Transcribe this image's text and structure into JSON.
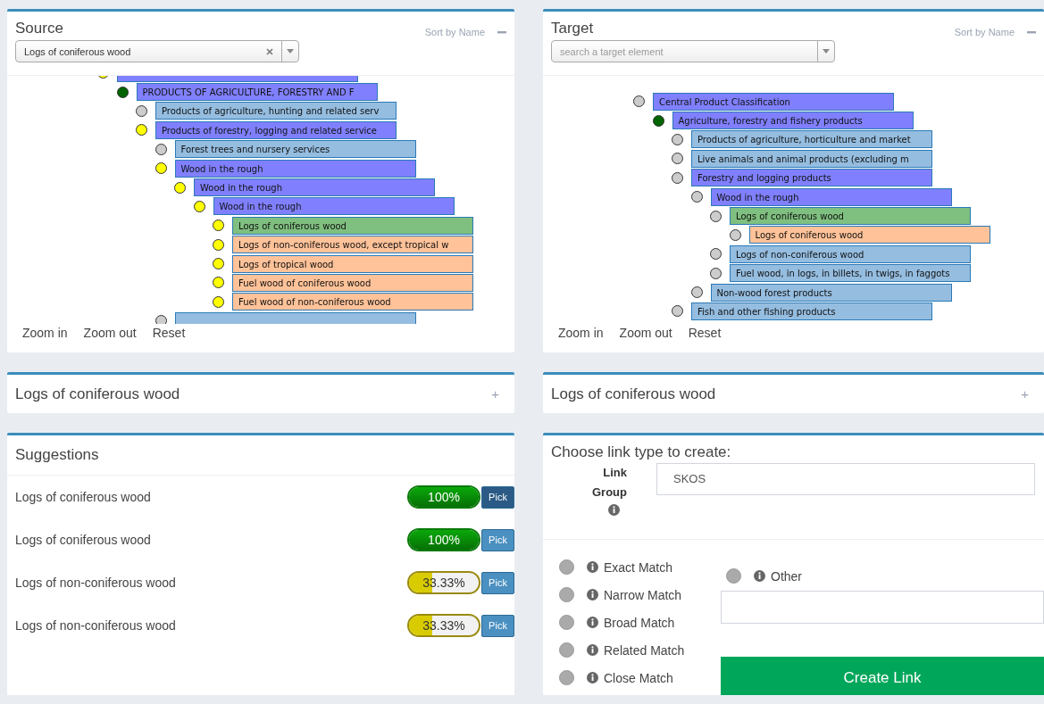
{
  "source": {
    "title": "Source",
    "sort_link": "Sort by Name",
    "search": {
      "value": "Logs of coniferous wood"
    },
    "tree": [
      {
        "kind": "group",
        "color": "#ffff00",
        "children": [
          {
            "label": "PRODUCTS OF AGRICULTURE, FORESTRY AND F",
            "kind": "group",
            "color": "#006400",
            "children": [
              {
                "label": "Products of agriculture, hunting and related serv",
                "kind": "other",
                "color": "#cccccc"
              },
              {
                "label": "Products of forestry, logging and related service",
                "kind": "group",
                "color": "#ffff00",
                "children": [
                  {
                    "label": "Forest trees and nursery services",
                    "kind": "other",
                    "color": "#cccccc"
                  },
                  {
                    "label": "Wood in the rough",
                    "kind": "group",
                    "color": "#ffff00",
                    "children": [
                      {
                        "label": "Wood in the rough",
                        "kind": "group",
                        "color": "#ffff00",
                        "children": [
                          {
                            "label": "Wood in the rough",
                            "kind": "group",
                            "color": "#ffff00",
                            "children": [
                              {
                                "label": "Logs of coniferous wood",
                                "kind": "match",
                                "color": "#ffff00"
                              },
                              {
                                "label": "Logs of non-coniferous wood, except tropical w",
                                "kind": "candidate",
                                "color": "#ffff00"
                              },
                              {
                                "label": "Logs of tropical wood",
                                "kind": "candidate",
                                "color": "#ffff00"
                              },
                              {
                                "label": "Fuel wood of coniferous wood",
                                "kind": "candidate",
                                "color": "#ffff00"
                              },
                              {
                                "label": "Fuel wood of non-coniferous wood",
                                "kind": "candidate",
                                "color": "#ffff00"
                              }
                            ]
                          }
                        ]
                      }
                    ]
                  },
                  {
                    "kind": "other",
                    "color": "#cccccc"
                  }
                ]
              }
            ]
          }
        ]
      }
    ],
    "zoom_links": [
      "Zoom in",
      "Zoom out",
      "Reset"
    ]
  },
  "target": {
    "title": "Target",
    "sort_link": "Sort by Name",
    "search": {
      "placeholder": "search a target element"
    },
    "tree": [
      {
        "label": "Central Product Classification",
        "kind": "group",
        "color": "#cccccc",
        "children": [
          {
            "label": "Agriculture, forestry and fishery products",
            "kind": "group",
            "color": "#006400",
            "children": [
              {
                "label": "Products of agriculture, horticulture and market",
                "kind": "other",
                "color": "#cccccc"
              },
              {
                "label": "Live animals and animal products (excluding m",
                "kind": "other",
                "color": "#cccccc"
              },
              {
                "label": "Forestry and logging products",
                "kind": "group",
                "color": "#cccccc",
                "children": [
                  {
                    "label": "Wood in the rough",
                    "kind": "group",
                    "color": "#cccccc",
                    "children": [
                      {
                        "label": "Logs of coniferous wood",
                        "kind": "match",
                        "color": "#cccccc",
                        "children": [
                          {
                            "label": "Logs of coniferous wood",
                            "kind": "candidate",
                            "color": "#cccccc"
                          }
                        ]
                      },
                      {
                        "label": "Logs of non-coniferous wood",
                        "kind": "other",
                        "color": "#cccccc"
                      },
                      {
                        "label": "Fuel wood, in logs, in billets, in twigs, in faggots",
                        "kind": "other",
                        "color": "#cccccc"
                      }
                    ]
                  },
                  {
                    "label": "Non-wood forest products",
                    "kind": "other",
                    "color": "#cccccc"
                  }
                ]
              },
              {
                "label": "Fish and other fishing products",
                "kind": "other",
                "color": "#cccccc"
              }
            ]
          }
        ]
      }
    ],
    "zoom_links": [
      "Zoom in",
      "Zoom out",
      "Reset"
    ]
  },
  "source_detail": {
    "title": "Logs of coniferous wood",
    "expand": "+"
  },
  "target_detail": {
    "title": "Logs of coniferous wood",
    "expand": "+"
  },
  "suggestions": {
    "title": "Suggestions",
    "items": [
      {
        "label": "Logs of coniferous wood",
        "score": "100%",
        "level": 1,
        "pick": "Pick",
        "selected": true
      },
      {
        "label": "Logs of coniferous wood",
        "score": "100%",
        "level": 1,
        "pick": "Pick",
        "selected": false
      },
      {
        "label": "Logs of non-coniferous wood",
        "score": "33.33%",
        "level": 0.3333,
        "pick": "Pick",
        "selected": false
      },
      {
        "label": "Logs of non-coniferous wood",
        "score": "33.33%",
        "level": 0.3333,
        "pick": "Pick",
        "selected": false
      }
    ]
  },
  "link": {
    "title": "Choose link type to create:",
    "group_label": "Link Group",
    "group_value": "SKOS",
    "types": [
      {
        "label": "Exact Match",
        "selected": false
      },
      {
        "label": "Narrow Match",
        "selected": false
      },
      {
        "label": "Broad Match",
        "selected": false
      },
      {
        "label": "Related Match",
        "selected": false
      },
      {
        "label": "Close Match",
        "selected": false
      }
    ],
    "other": {
      "label": "Other",
      "selected": false
    },
    "create": "Create Link"
  }
}
